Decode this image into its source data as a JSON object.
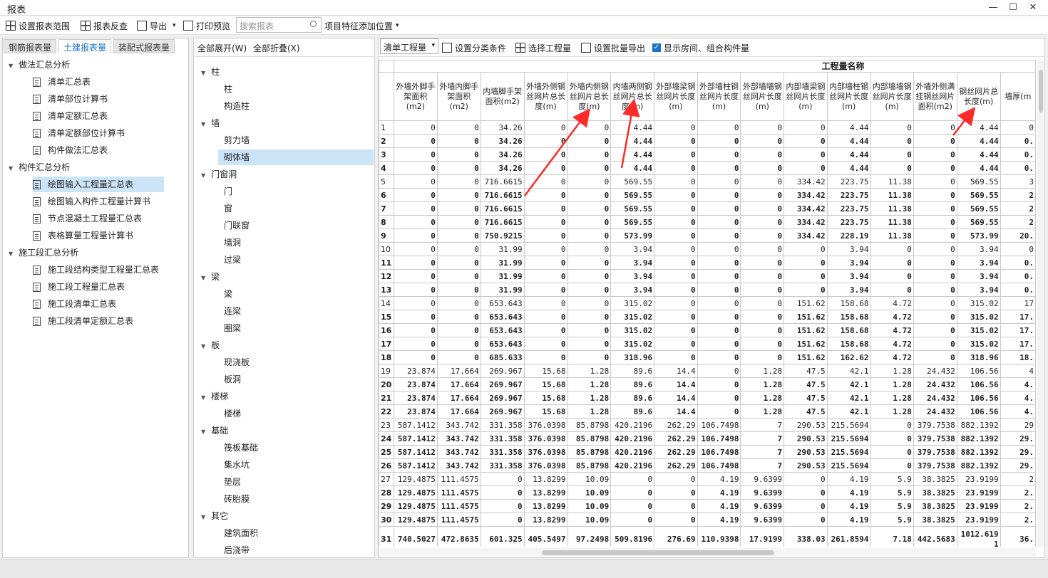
{
  "window": {
    "title": "报表"
  },
  "toolbar": {
    "set_range": "设置报表范围",
    "check": "报表反查",
    "export": "导出",
    "print": "打印预览",
    "search_placeholder": "搜索报表",
    "feature": "项目特征添加位置"
  },
  "tabs": [
    "钢筋报表量",
    "土建报表量",
    "装配式报表量"
  ],
  "tree": [
    {
      "label": "做法汇总分析",
      "group": true
    },
    {
      "label": "清单汇总表"
    },
    {
      "label": "清单部位计算书"
    },
    {
      "label": "清单定额汇总表"
    },
    {
      "label": "清单定额部位计算书"
    },
    {
      "label": "构件做法汇总表"
    },
    {
      "label": "构件汇总分析",
      "group": true
    },
    {
      "label": "绘图输入工程量汇总表",
      "selected": true
    },
    {
      "label": "绘图输入构件工程量计算书"
    },
    {
      "label": "节点混凝土工程量汇总表"
    },
    {
      "label": "表格算量工程量计算书"
    },
    {
      "label": "施工段汇总分析",
      "group": true
    },
    {
      "label": "施工段结构类型工程量汇总表"
    },
    {
      "label": "施工段工程量汇总表"
    },
    {
      "label": "施工段清单汇总表"
    },
    {
      "label": "施工段清单定额汇总表"
    }
  ],
  "mid": {
    "expand": "全部展开(W)",
    "collapse": "全部折叠(X)",
    "items": [
      {
        "label": "柱",
        "group": true
      },
      {
        "label": "柱"
      },
      {
        "label": "构造柱"
      },
      {
        "label": "墙",
        "group": true
      },
      {
        "label": "剪力墙"
      },
      {
        "label": "砌体墙",
        "selected": true
      },
      {
        "label": "门窗洞",
        "group": true
      },
      {
        "label": "门"
      },
      {
        "label": "窗"
      },
      {
        "label": "门联窗"
      },
      {
        "label": "墙洞"
      },
      {
        "label": "过梁"
      },
      {
        "label": "梁",
        "group": true
      },
      {
        "label": "梁"
      },
      {
        "label": "连梁"
      },
      {
        "label": "圈梁"
      },
      {
        "label": "板",
        "group": true
      },
      {
        "label": "现浇板"
      },
      {
        "label": "板洞"
      },
      {
        "label": "楼梯",
        "group": true
      },
      {
        "label": "楼梯"
      },
      {
        "label": "基础",
        "group": true
      },
      {
        "label": "筏板基础"
      },
      {
        "label": "集水坑"
      },
      {
        "label": "垫层"
      },
      {
        "label": "砖胎膜"
      },
      {
        "label": "其它",
        "group": true
      },
      {
        "label": "建筑面积"
      },
      {
        "label": "后浇带"
      }
    ]
  },
  "rightbar": {
    "select": "清单工程量",
    "cond": "设置分类条件",
    "choose": "选择工程量",
    "batch": "设置批量导出",
    "show": "显示房间、组合构件量"
  },
  "table": {
    "band": "工程量名称",
    "headers": [
      "外墙外脚手架面积(m2)",
      "外墙内脚手架面积(m2)",
      "内墙脚手架面积(m2)",
      "外墙外侧钢丝网片总长度(m)",
      "外墙内侧钢丝网片总长度(m)",
      "内墙两侧钢丝网片总长度(m)",
      "外部墙梁钢丝网片长度(m)",
      "外部墙柱钢丝网片长度(m)",
      "外部墙墙钢丝网片长度(m)",
      "内部墙梁钢丝网片长度(m)",
      "内部墙柱钢丝网片长度(m)",
      "内部墙墙钢丝网片长度(m)",
      "外墙外侧满挂钢丝网片面积(m2)",
      "钢丝网片总长度(m)",
      "墙厚(m"
    ],
    "rows": [
      {
        "n": "1",
        "b": false,
        "v": [
          "0",
          "0",
          "34.26",
          "0",
          "0",
          "4.44",
          "0",
          "0",
          "0",
          "0",
          "4.44",
          "0",
          "0",
          "4.44",
          "0"
        ]
      },
      {
        "n": "2",
        "b": true,
        "v": [
          "0",
          "0",
          "34.26",
          "0",
          "0",
          "4.44",
          "0",
          "0",
          "0",
          "0",
          "4.44",
          "0",
          "0",
          "4.44",
          "0."
        ]
      },
      {
        "n": "3",
        "b": true,
        "v": [
          "0",
          "0",
          "34.26",
          "0",
          "0",
          "4.44",
          "0",
          "0",
          "0",
          "0",
          "4.44",
          "0",
          "0",
          "4.44",
          "0."
        ]
      },
      {
        "n": "4",
        "b": true,
        "v": [
          "0",
          "0",
          "34.26",
          "0",
          "0",
          "4.44",
          "0",
          "0",
          "0",
          "0",
          "4.44",
          "0",
          "0",
          "4.44",
          "0."
        ]
      },
      {
        "n": "5",
        "b": false,
        "v": [
          "0",
          "0",
          "716.6615",
          "0",
          "0",
          "569.55",
          "0",
          "0",
          "0",
          "334.42",
          "223.75",
          "11.38",
          "0",
          "569.55",
          "3"
        ]
      },
      {
        "n": "6",
        "b": true,
        "v": [
          "0",
          "0",
          "716.6615",
          "0",
          "0",
          "569.55",
          "0",
          "0",
          "0",
          "334.42",
          "223.75",
          "11.38",
          "0",
          "569.55",
          "2"
        ]
      },
      {
        "n": "7",
        "b": true,
        "v": [
          "0",
          "0",
          "716.6615",
          "0",
          "0",
          "569.55",
          "0",
          "0",
          "0",
          "334.42",
          "223.75",
          "11.38",
          "0",
          "569.55",
          "2"
        ]
      },
      {
        "n": "8",
        "b": true,
        "v": [
          "0",
          "0",
          "716.6615",
          "0",
          "0",
          "569.55",
          "0",
          "0",
          "0",
          "334.42",
          "223.75",
          "11.38",
          "0",
          "569.55",
          "2"
        ]
      },
      {
        "n": "9",
        "b": true,
        "v": [
          "0",
          "0",
          "750.9215",
          "0",
          "0",
          "573.99",
          "0",
          "0",
          "0",
          "334.42",
          "228.19",
          "11.38",
          "0",
          "573.99",
          "20."
        ]
      },
      {
        "n": "10",
        "b": false,
        "v": [
          "0",
          "0",
          "31.99",
          "0",
          "0",
          "3.94",
          "0",
          "0",
          "0",
          "0",
          "3.94",
          "0",
          "0",
          "3.94",
          "0"
        ]
      },
      {
        "n": "11",
        "b": true,
        "v": [
          "0",
          "0",
          "31.99",
          "0",
          "0",
          "3.94",
          "0",
          "0",
          "0",
          "0",
          "3.94",
          "0",
          "0",
          "3.94",
          "0."
        ]
      },
      {
        "n": "12",
        "b": true,
        "v": [
          "0",
          "0",
          "31.99",
          "0",
          "0",
          "3.94",
          "0",
          "0",
          "0",
          "0",
          "3.94",
          "0",
          "0",
          "3.94",
          "0."
        ]
      },
      {
        "n": "13",
        "b": true,
        "v": [
          "0",
          "0",
          "31.99",
          "0",
          "0",
          "3.94",
          "0",
          "0",
          "0",
          "0",
          "3.94",
          "0",
          "0",
          "3.94",
          "0."
        ]
      },
      {
        "n": "14",
        "b": false,
        "v": [
          "0",
          "0",
          "653.643",
          "0",
          "0",
          "315.02",
          "0",
          "0",
          "0",
          "151.62",
          "158.68",
          "4.72",
          "0",
          "315.02",
          "17"
        ]
      },
      {
        "n": "15",
        "b": true,
        "v": [
          "0",
          "0",
          "653.643",
          "0",
          "0",
          "315.02",
          "0",
          "0",
          "0",
          "151.62",
          "158.68",
          "4.72",
          "0",
          "315.02",
          "17."
        ]
      },
      {
        "n": "16",
        "b": true,
        "v": [
          "0",
          "0",
          "653.643",
          "0",
          "0",
          "315.02",
          "0",
          "0",
          "0",
          "151.62",
          "158.68",
          "4.72",
          "0",
          "315.02",
          "17."
        ]
      },
      {
        "n": "17",
        "b": true,
        "v": [
          "0",
          "0",
          "653.643",
          "0",
          "0",
          "315.02",
          "0",
          "0",
          "0",
          "151.62",
          "158.68",
          "4.72",
          "0",
          "315.02",
          "17."
        ]
      },
      {
        "n": "18",
        "b": true,
        "v": [
          "0",
          "0",
          "685.633",
          "0",
          "0",
          "318.96",
          "0",
          "0",
          "0",
          "151.62",
          "162.62",
          "4.72",
          "0",
          "318.96",
          "18."
        ]
      },
      {
        "n": "19",
        "b": false,
        "v": [
          "23.874",
          "17.664",
          "269.967",
          "15.68",
          "1.28",
          "89.6",
          "14.4",
          "0",
          "1.28",
          "47.5",
          "42.1",
          "1.28",
          "24.432",
          "106.56",
          "4"
        ]
      },
      {
        "n": "20",
        "b": true,
        "v": [
          "23.874",
          "17.664",
          "269.967",
          "15.68",
          "1.28",
          "89.6",
          "14.4",
          "0",
          "1.28",
          "47.5",
          "42.1",
          "1.28",
          "24.432",
          "106.56",
          "4."
        ]
      },
      {
        "n": "21",
        "b": true,
        "v": [
          "23.874",
          "17.664",
          "269.967",
          "15.68",
          "1.28",
          "89.6",
          "14.4",
          "0",
          "1.28",
          "47.5",
          "42.1",
          "1.28",
          "24.432",
          "106.56",
          "4."
        ]
      },
      {
        "n": "22",
        "b": true,
        "v": [
          "23.874",
          "17.664",
          "269.967",
          "15.68",
          "1.28",
          "89.6",
          "14.4",
          "0",
          "1.28",
          "47.5",
          "42.1",
          "1.28",
          "24.432",
          "106.56",
          "4."
        ]
      },
      {
        "n": "23",
        "b": false,
        "v": [
          "587.1412",
          "343.742",
          "331.358",
          "376.0398",
          "85.8798",
          "420.2196",
          "262.29",
          "106.7498",
          "7",
          "290.53",
          "215.5694",
          "0",
          "379.7538",
          "882.1392",
          "29"
        ]
      },
      {
        "n": "24",
        "b": true,
        "v": [
          "587.1412",
          "343.742",
          "331.358",
          "376.0398",
          "85.8798",
          "420.2196",
          "262.29",
          "106.7498",
          "7",
          "290.53",
          "215.5694",
          "0",
          "379.7538",
          "882.1392",
          "29."
        ]
      },
      {
        "n": "25",
        "b": true,
        "v": [
          "587.1412",
          "343.742",
          "331.358",
          "376.0398",
          "85.8798",
          "420.2196",
          "262.29",
          "106.7498",
          "7",
          "290.53",
          "215.5694",
          "0",
          "379.7538",
          "882.1392",
          "29."
        ]
      },
      {
        "n": "26",
        "b": true,
        "v": [
          "587.1412",
          "343.742",
          "331.358",
          "376.0398",
          "85.8798",
          "420.2196",
          "262.29",
          "106.7498",
          "7",
          "290.53",
          "215.5694",
          "0",
          "379.7538",
          "882.1392",
          "29."
        ]
      },
      {
        "n": "27",
        "b": false,
        "v": [
          "129.4875",
          "111.4575",
          "0",
          "13.8299",
          "10.09",
          "0",
          "0",
          "4.19",
          "9.6399",
          "0",
          "4.19",
          "5.9",
          "38.3825",
          "23.9199",
          "2"
        ]
      },
      {
        "n": "28",
        "b": true,
        "v": [
          "129.4875",
          "111.4575",
          "0",
          "13.8299",
          "10.09",
          "0",
          "0",
          "4.19",
          "9.6399",
          "0",
          "4.19",
          "5.9",
          "38.3825",
          "23.9199",
          "2."
        ]
      },
      {
        "n": "29",
        "b": true,
        "v": [
          "129.4875",
          "111.4575",
          "0",
          "13.8299",
          "10.09",
          "0",
          "0",
          "4.19",
          "9.6399",
          "0",
          "4.19",
          "5.9",
          "38.3825",
          "23.9199",
          "2."
        ]
      },
      {
        "n": "30",
        "b": true,
        "v": [
          "129.4875",
          "111.4575",
          "0",
          "13.8299",
          "10.09",
          "0",
          "0",
          "4.19",
          "9.6399",
          "0",
          "4.19",
          "5.9",
          "38.3825",
          "23.9199",
          "2."
        ]
      },
      {
        "n": "31",
        "b": true,
        "v": [
          "740.5027",
          "472.8635",
          "601.325",
          "405.5497",
          "97.2498",
          "509.8196",
          "276.69",
          "110.9398",
          "17.9199",
          "338.03",
          "261.8594",
          "7.18",
          "442.5683",
          "1012.619 1",
          "36."
        ]
      }
    ]
  },
  "colors": {
    "accent": "#1a73c8",
    "selected": "#cce4f7",
    "arrow": "#ff2a2a"
  }
}
